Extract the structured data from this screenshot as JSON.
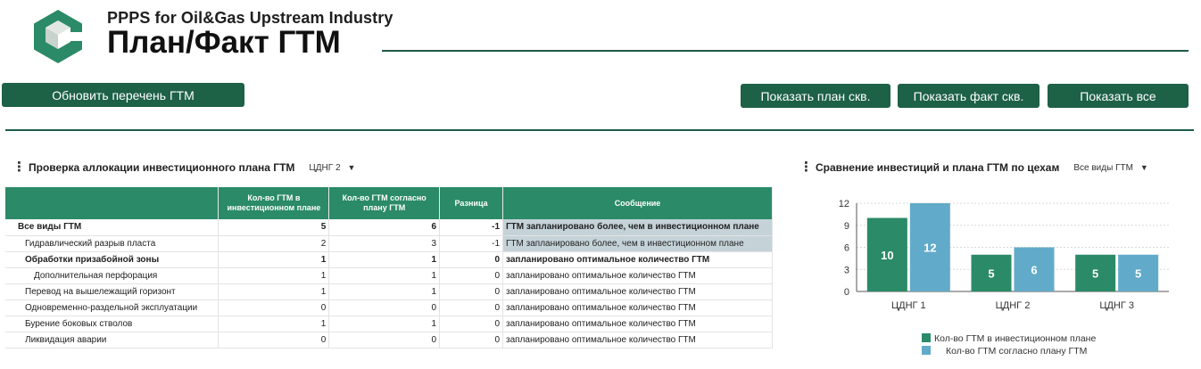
{
  "header": {
    "subtitle": "PPPS for Oil&Gas Upstream Industry",
    "title": "План/Факт ГТМ"
  },
  "toolbar": {
    "refresh_label": "Обновить перечень ГТМ",
    "show_plan_label": "Показать план скв.",
    "show_fact_label": "Показать факт скв.",
    "show_all_label": "Показать все"
  },
  "allocation": {
    "title": "Проверка аллокации инвестиционного плана ГТМ",
    "filter": "ЦДНГ 2",
    "columns": [
      "",
      "Кол-во ГТМ в инвестиционном плане",
      "Кол-во ГТМ согласно плану ГТМ",
      "Разница",
      "Сообщение"
    ],
    "rows": [
      {
        "name": "Все виды ГТМ",
        "invest": "5",
        "plan": "6",
        "diff": "-1",
        "message": "ГТМ запланировано более, чем в инвестиционном плане",
        "level": 0,
        "bold": true,
        "highlight": true
      },
      {
        "name": "Гидравлический разрыв пласта",
        "invest": "2",
        "plan": "3",
        "diff": "-1",
        "message": "ГТМ запланировано более, чем в инвестиционном плане",
        "level": 1,
        "bold": false,
        "highlight": true
      },
      {
        "name": "Обработки призабойной зоны",
        "invest": "1",
        "plan": "1",
        "diff": "0",
        "message": "запланировано оптимальное количество ГТМ",
        "level": 1,
        "bold": true,
        "highlight": false
      },
      {
        "name": "Дополнительная перфорация",
        "invest": "1",
        "plan": "1",
        "diff": "0",
        "message": "запланировано оптимальное количество ГТМ",
        "level": 2,
        "bold": false,
        "highlight": false
      },
      {
        "name": "Перевод на вышележащий горизонт",
        "invest": "1",
        "plan": "1",
        "diff": "0",
        "message": "запланировано оптимальное количество ГТМ",
        "level": 1,
        "bold": false,
        "highlight": false
      },
      {
        "name": "Одновременно-раздельной эксплуатации",
        "invest": "0",
        "plan": "0",
        "diff": "0",
        "message": "запланировано оптимальное количество ГТМ",
        "level": 1,
        "bold": false,
        "highlight": false
      },
      {
        "name": "Бурение боковых стволов",
        "invest": "1",
        "plan": "1",
        "diff": "0",
        "message": "запланировано оптимальное количество ГТМ",
        "level": 1,
        "bold": false,
        "highlight": false
      },
      {
        "name": "Ликвидация аварии",
        "invest": "0",
        "plan": "0",
        "diff": "0",
        "message": "запланировано оптимальное количество ГТМ",
        "level": 1,
        "bold": false,
        "highlight": false
      }
    ]
  },
  "comparison": {
    "title": "Сравнение инвестиций и плана ГТМ по цехам",
    "filter": "Все виды ГТМ"
  },
  "chart_data": {
    "type": "bar",
    "categories": [
      "ЦДНГ 1",
      "ЦДНГ 2",
      "ЦДНГ 3"
    ],
    "series": [
      {
        "name": "Кол-во ГТМ в инвестиционном плане",
        "values": [
          10,
          5,
          5
        ],
        "color": "#2b8a68"
      },
      {
        "name": "Кол-во ГТМ согласно плану ГТМ",
        "values": [
          12,
          6,
          5
        ],
        "color": "#62aac9"
      }
    ],
    "yticks": [
      0,
      3,
      6,
      9,
      12
    ],
    "ylim": [
      0,
      12
    ],
    "grid": true,
    "legend": "bottom"
  },
  "colors": {
    "brand": "#1d6147",
    "header_fill": "#2b8a68",
    "highlight": "#c5d3d9"
  },
  "icons": {
    "menu": "kebab-icon",
    "dropdown": "caret-down-icon"
  }
}
